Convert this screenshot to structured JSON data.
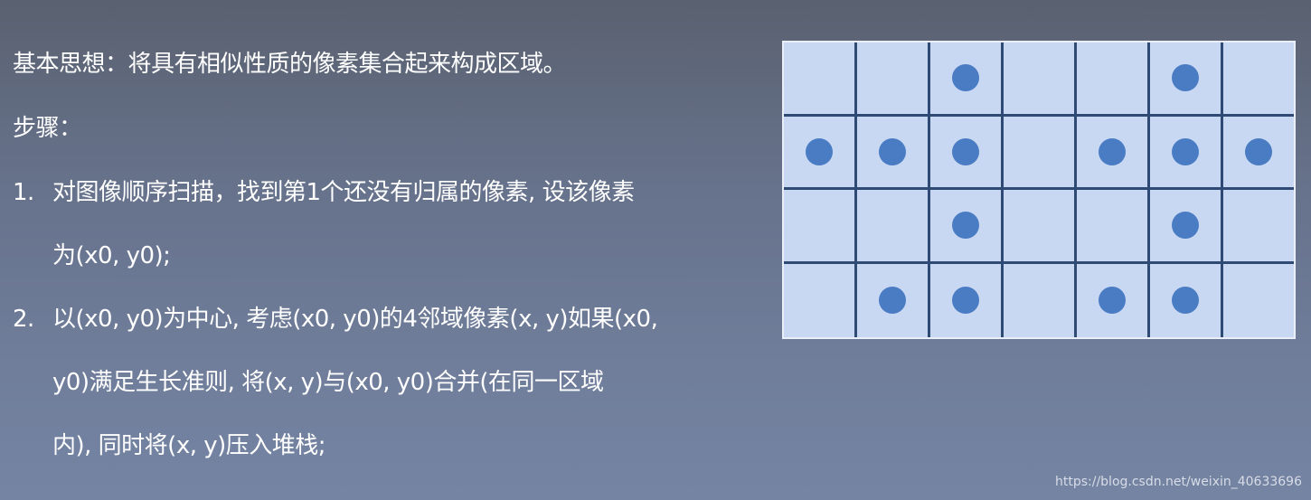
{
  "text": {
    "idea": "基本思想：将具有相似性质的像素集合起来构成区域。",
    "steps_heading": "步骤：",
    "step1": {
      "number": "1.",
      "line1": "对图像顺序扫描，找到第1个还没有归属的像素, 设该像素",
      "line2": "为(x0, y0);"
    },
    "step2": {
      "number": "2.",
      "line1": "以(x0, y0)为中心, 考虑(x0, y0)的4邻域像素(x, y)如果(x0,",
      "line2": "y0)满足生长准则, 将(x, y)与(x0, y0)合并(在同一区域",
      "line3": "内), 同时将(x, y)压入堆栈;"
    }
  },
  "diagram": {
    "rows": 4,
    "cols": 7,
    "filled_cells": [
      [
        0,
        0,
        1,
        0,
        0,
        1,
        0
      ],
      [
        1,
        1,
        1,
        0,
        1,
        1,
        1
      ],
      [
        0,
        0,
        1,
        0,
        0,
        1,
        0
      ],
      [
        0,
        1,
        1,
        0,
        1,
        1,
        0
      ]
    ],
    "colors": {
      "cell": "#c9d8f2",
      "grid_line": "#2f4a74",
      "dot": "#4a7cc4"
    }
  },
  "watermark": "https://blog.csdn.net/weixin_40633696"
}
